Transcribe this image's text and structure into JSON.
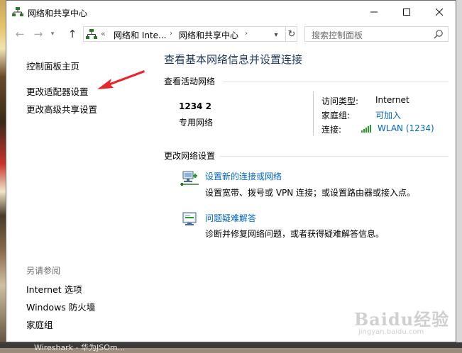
{
  "window": {
    "title": "网络和共享中心"
  },
  "address_bar": {
    "chevron": "«",
    "crumbs": [
      "网络和 Inte...",
      "网络和共享中心"
    ],
    "separator": "›",
    "refresh_icon": "refresh-icon"
  },
  "search": {
    "placeholder": "搜索控制面板"
  },
  "sidebar": {
    "home": "控制面板主页",
    "adapter": "更改适配器设置",
    "sharing": "更改高级共享设置",
    "see_also": "另请参阅",
    "internet_options": "Internet 选项",
    "firewall": "Windows 防火墙",
    "homegroup": "家庭组"
  },
  "main": {
    "title": "查看基本网络信息并设置连接",
    "active_networks_label": "查看活动网络",
    "network_name": "1234  2",
    "network_type": "专用网络",
    "access_type_label": "访问类型:",
    "access_type_value": "Internet",
    "homegroup_label": "家庭组:",
    "homegroup_value": "可加入",
    "connections_label": "连接:",
    "connections_value": "WLAN (1234)",
    "change_settings_label": "更改网络设置",
    "task1_link": "设置新的连接或网络",
    "task1_desc": "设置宽带、拨号或 VPN 连接；或设置路由器或接入点。",
    "task2_link": "问题疑难解答",
    "task2_desc": "诊断并修复网络问题，或者获得疑难解答信息。"
  },
  "watermark": {
    "brand": "Baidu经验",
    "url": "jingyan.baidu.com"
  },
  "taskbar_text": "Wireshark - 华为JSOm...",
  "colors": {
    "accent": "#1e395b",
    "link": "#0066cc",
    "annotation": "#e8262d"
  }
}
